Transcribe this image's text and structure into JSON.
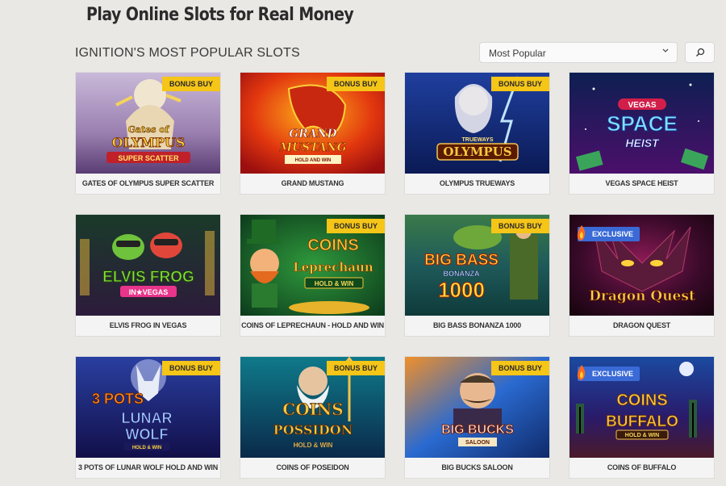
{
  "page": {
    "title": "Play Online Slots for Real Money",
    "section_title": "IGNITION'S MOST POPULAR SLOTS"
  },
  "sort": {
    "selected": "Most Popular",
    "icon": "chevron-down-icon"
  },
  "search": {
    "icon": "search-icon"
  },
  "badges": {
    "bonus_buy": "BONUS BUY",
    "exclusive": "EXCLUSIVE"
  },
  "games": [
    {
      "name": "GATES OF OLYMPUS SUPER SCATTER",
      "badge": "BONUS BUY",
      "logo": [
        "Gates of",
        "OLYMPUS",
        "SUPER SCATTER"
      ]
    },
    {
      "name": "GRAND MUSTANG",
      "badge": "BONUS BUY",
      "logo": [
        "GRAND",
        "MUSTANG",
        "HOLD AND WIN"
      ]
    },
    {
      "name": "OLYMPUS TRUEWAYS",
      "badge": "BONUS BUY",
      "logo": [
        "TRUEWAYS",
        "OLYMPUS"
      ]
    },
    {
      "name": "VEGAS SPACE HEIST",
      "badge": "",
      "logo": [
        "VEGAS",
        "SPACE",
        "HEIST"
      ]
    },
    {
      "name": "ELVIS FROG IN VEGAS",
      "badge": "",
      "logo": [
        "ELVIS FROG",
        "IN★VEGAS"
      ]
    },
    {
      "name": "COINS OF LEPRECHAUN - HOLD AND WIN",
      "badge": "BONUS BUY",
      "logo": [
        "COINS",
        "Leprechaun",
        "HOLD & WIN"
      ]
    },
    {
      "name": "BIG BASS BONANZA 1000",
      "badge": "BONUS BUY",
      "logo": [
        "BIG BASS",
        "BONANZA",
        "1000"
      ]
    },
    {
      "name": "DRAGON QUEST",
      "badge": "EXCLUSIVE",
      "logo": [
        "Dragon Quest"
      ]
    },
    {
      "name": "3 POTS OF LUNAR WOLF HOLD AND WIN",
      "badge": "BONUS BUY",
      "logo": [
        "3 POTS",
        "LUNAR",
        "WOLF",
        "HOLD & WIN"
      ]
    },
    {
      "name": "COINS OF POSEIDON",
      "badge": "BONUS BUY",
      "logo": [
        "COINS",
        "POSSIDON",
        "HOLD & WIN"
      ]
    },
    {
      "name": "BIG BUCKS SALOON",
      "badge": "BONUS BUY",
      "logo": [
        "BIG BUCKS",
        "SALOON"
      ]
    },
    {
      "name": "COINS OF BUFFALO",
      "badge": "EXCLUSIVE",
      "logo": [
        "COINS",
        "BUFFALO",
        "HOLD & WIN"
      ]
    }
  ],
  "colors": {
    "background": "#e9e8e4",
    "badge_bonus": "#f5c518",
    "badge_exclusive": "#3a6ad6"
  }
}
